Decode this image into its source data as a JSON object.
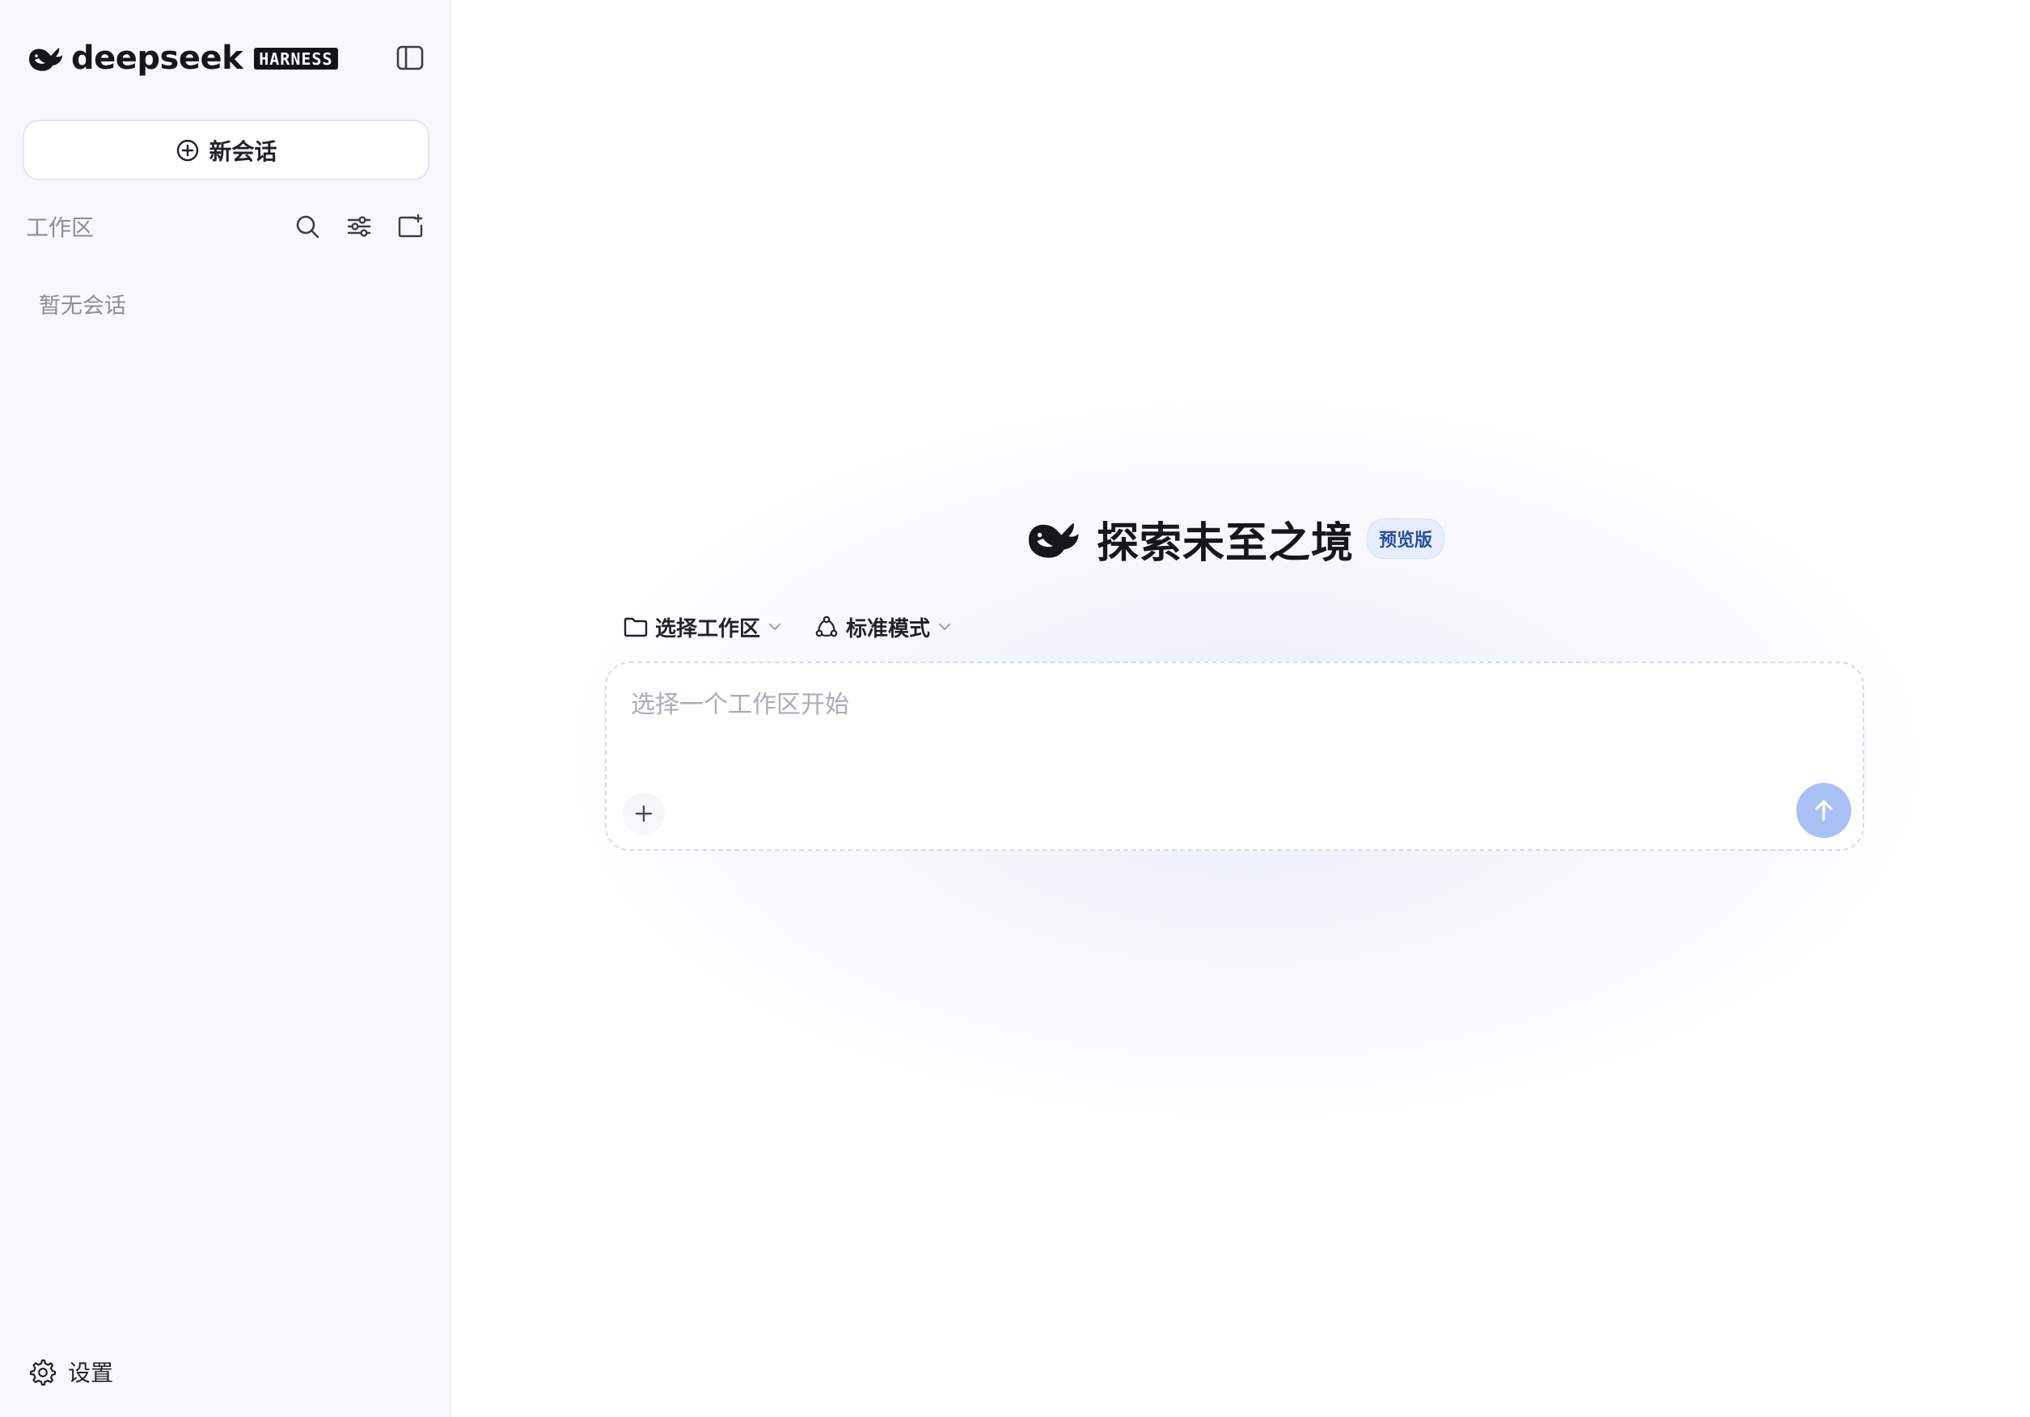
{
  "sidebar": {
    "brand_name": "deepseek",
    "brand_badge": "HARNESS",
    "new_chat_label": "新会话",
    "workspace_title": "工作区",
    "empty_text": "暂无会话",
    "settings_label": "设置",
    "icons": [
      "deepseek-whale-logo",
      "sidebar-toggle-icon",
      "plus-circle-icon",
      "search-icon",
      "sliders-icon",
      "folder-plus-icon",
      "gear-icon"
    ]
  },
  "main": {
    "hero_title": "探索未至之境",
    "hero_badge": "预览版",
    "workspace_select_label": "选择工作区",
    "mode_select_label": "标准模式",
    "composer_placeholder": "选择一个工作区开始",
    "send_disabled": true,
    "icons": [
      "folder-icon",
      "mode-cycle-icon",
      "chevron-down-icon",
      "plus-icon",
      "arrow-up-icon"
    ]
  },
  "colors": {
    "sidebar_bg": "#f6f8fb",
    "text_primary": "#1f2329",
    "text_muted": "#8a909a",
    "badge_bg": "#e6eefc",
    "badge_text": "#2a4d9c",
    "send_button": "#a9c0f5"
  }
}
